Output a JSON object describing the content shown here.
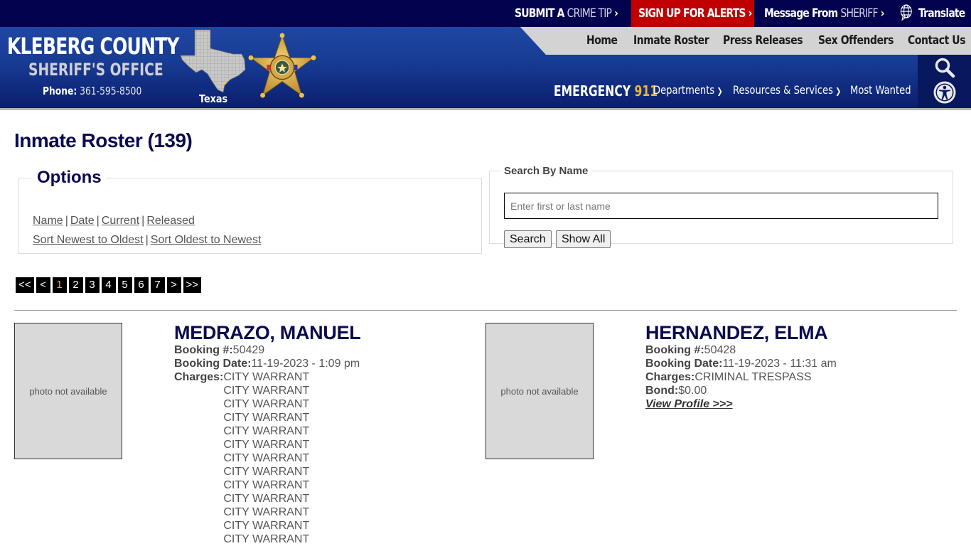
{
  "topbar": {
    "crime_tip": {
      "a": "SUBMIT A",
      "b": "CRIME TIP",
      "arrow": "›"
    },
    "alerts": {
      "label": "SIGN UP FOR ALERTS",
      "arrow": "›",
      "bg": "#c00000"
    },
    "message": {
      "a": "Message From",
      "b": "SHERIFF",
      "arrow": "›"
    },
    "translate": "Translate"
  },
  "logo": {
    "title": "KLEBERG COUNTY",
    "subtitle": "SHERIFF'S OFFICE",
    "phone_label": "Phone:",
    "phone": "361-595-8500",
    "state_label": "Texas"
  },
  "nav": {
    "items": [
      "Home",
      "Inmate Roster",
      "Press Releases",
      "Sex Offenders",
      "Contact Us"
    ]
  },
  "subnav": {
    "emergency": "EMERGENCY",
    "emergency_number": "911",
    "departments": "Departments",
    "resources": "Resources & Services",
    "most_wanted": "Most Wanted"
  },
  "page": {
    "title": "Inmate Roster (139)"
  },
  "options": {
    "legend": "Options",
    "filters": [
      "Name",
      "Date",
      "Current",
      "Released"
    ],
    "sorts": [
      "Sort Newest to Oldest",
      "Sort Oldest to Newest"
    ],
    "separator": "|"
  },
  "search": {
    "legend": "Search By Name",
    "placeholder": "Enter first or last name",
    "value": "",
    "search_button": "Search",
    "show_all_button": "Show All"
  },
  "pagination": {
    "first": "<<",
    "prev": "<",
    "pages": [
      "1",
      "2",
      "3",
      "4",
      "5",
      "6",
      "7"
    ],
    "current": "1",
    "next": ">",
    "last": ">>"
  },
  "inmates": [
    {
      "name": "MEDRAZO, MANUEL",
      "photo_text": "photo not available",
      "booking_label": "Booking #:",
      "booking_number": "50429",
      "date_label": "Booking Date:",
      "booking_date": "11-19-2023 - 1:09 pm",
      "charges_label": "Charges:",
      "charges": [
        "CITY WARRANT",
        "CITY WARRANT",
        "CITY WARRANT",
        "CITY WARRANT",
        "CITY WARRANT",
        "CITY WARRANT",
        "CITY WARRANT",
        "CITY WARRANT",
        "CITY WARRANT",
        "CITY WARRANT",
        "CITY WARRANT",
        "CITY WARRANT",
        "CITY WARRANT"
      ]
    },
    {
      "name": "HERNANDEZ, ELMA",
      "photo_text": "photo not available",
      "booking_label": "Booking #:",
      "booking_number": "50428",
      "date_label": "Booking Date:",
      "booking_date": "11-19-2023 - 11:31 am",
      "charges_label": "Charges:",
      "charges": [
        "CRIMINAL TRESPASS"
      ],
      "bond_label": "Bond:",
      "bond": "$0.00",
      "view_profile": "View Profile >>>"
    }
  ]
}
